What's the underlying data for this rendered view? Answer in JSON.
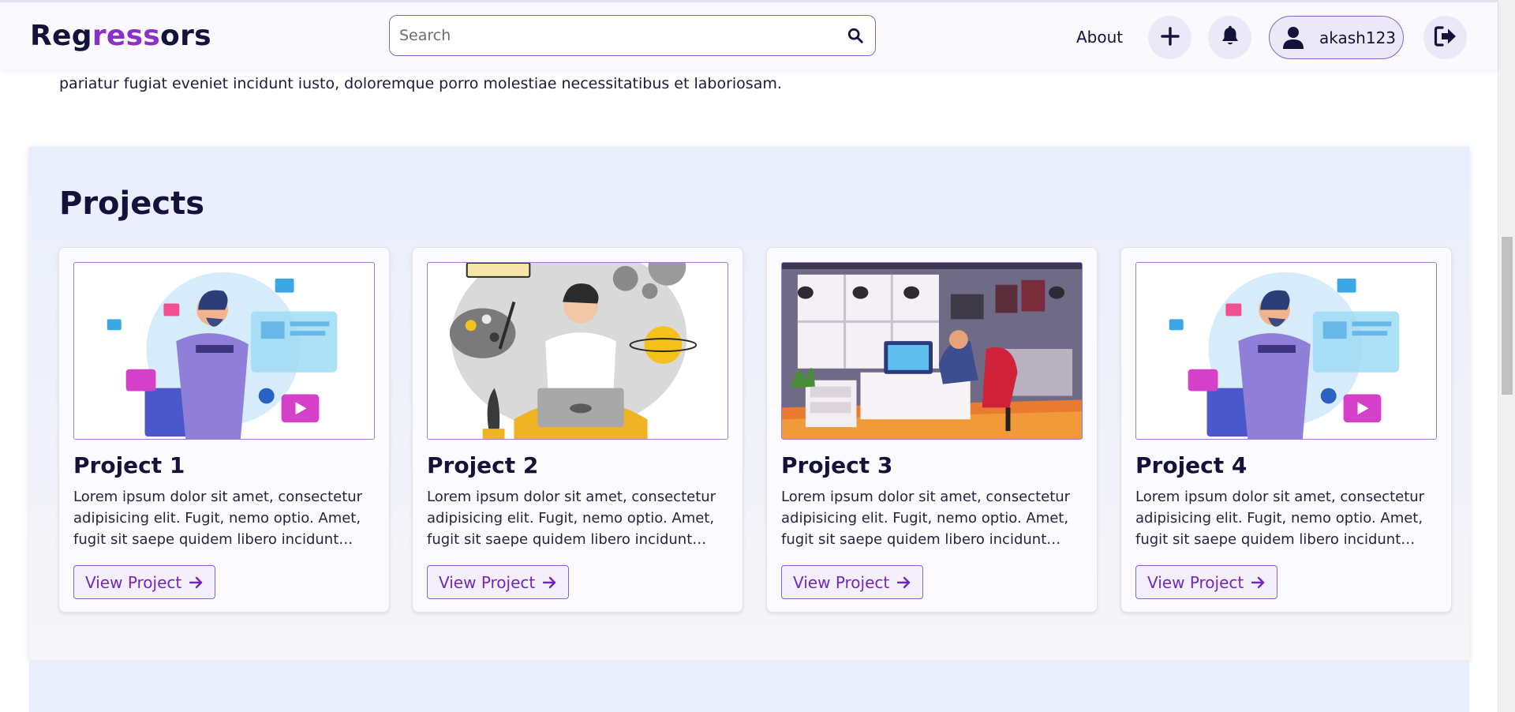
{
  "nav": {
    "logo_part1": "Reg",
    "logo_part2": "ress",
    "logo_part3": "ors",
    "search_placeholder": "Search",
    "about_label": "About",
    "username": "akash123",
    "icons": [
      "search-icon",
      "plus-icon",
      "bell-icon",
      "user-icon",
      "logout-icon"
    ]
  },
  "intro": {
    "text": "pariatur fugiat eveniet incidunt iusto, doloremque porro molestiae necessitatibus et laboriosam."
  },
  "projects": {
    "title": "Projects",
    "button_label": "View Project",
    "items": [
      {
        "title": "Project 1",
        "description": "Lorem ipsum dolor sit amet, consectetur adipisicing elit. Fugit, nemo optio. Amet, fugit sit saepe quidem libero incidunt voluptatum.",
        "image": "designer-illustration"
      },
      {
        "title": "Project 2",
        "description": "Lorem ipsum dolor sit amet, consectetur adipisicing elit. Fugit, nemo optio. Amet, fugit sit saepe quidem libero incidunt voluptatum.",
        "image": "laptop-person-illustration"
      },
      {
        "title": "Project 3",
        "description": "Lorem ipsum dolor sit amet, consectetur adipisicing elit. Fugit, nemo optio. Amet, fugit sit saepe quidem libero incidunt voluptatum.",
        "image": "office-desk-illustration"
      },
      {
        "title": "Project 4",
        "description": "Lorem ipsum dolor sit amet, consectetur adipisicing elit. Fugit, nemo optio. Amet, fugit sit saepe quidem libero incidunt voluptatum.",
        "image": "designer-illustration"
      }
    ]
  },
  "colors": {
    "brand_dark": "#14123a",
    "brand_accent": "#8b2fc9",
    "button_text": "#7426c0",
    "section_bg": "#e9eefc"
  }
}
